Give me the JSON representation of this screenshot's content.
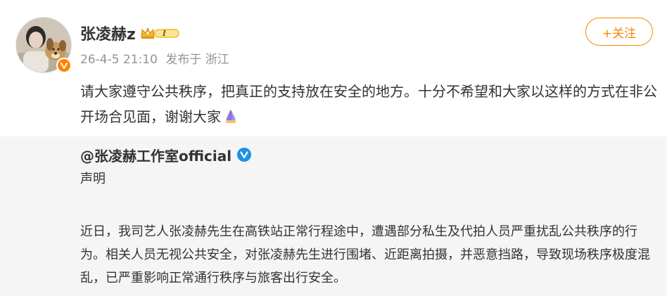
{
  "author": {
    "name": "张凌赫z",
    "vip_level": "I",
    "timestamp": "26-4-5 21:10",
    "source": "发布于 浙江",
    "follow_label": "+关注"
  },
  "post": {
    "text": "请大家遵守公共秩序，把真正的支持放在安全的地方。十分不希望和大家以这样的方式在非公开场合见面，谢谢大家"
  },
  "repost": {
    "author": "@张凌赫工作室official",
    "title": "声明",
    "body": "近日，我司艺人张凌赫先生在高铁站正常行程途中，遭遇部分私生及代拍人员严重扰乱公共秩序的行为。相关人员无视公共安全，对张凌赫先生进行围堵、近距离拍摄，并恶意挡路，导致现场秩序极度混乱，已严重影响正常通行秩序与旅客出行安全。"
  },
  "colors": {
    "accent": "#ff8200",
    "repost_bg": "#f5f5f5",
    "verified_blue": "#1c91e6",
    "meta_text": "#939393"
  },
  "icons": {
    "vip": "crown-vip-icon",
    "verified": "verified-v-icon",
    "orange_v": "orange-v-badge-icon",
    "emoji": "praying-hands-icon"
  }
}
